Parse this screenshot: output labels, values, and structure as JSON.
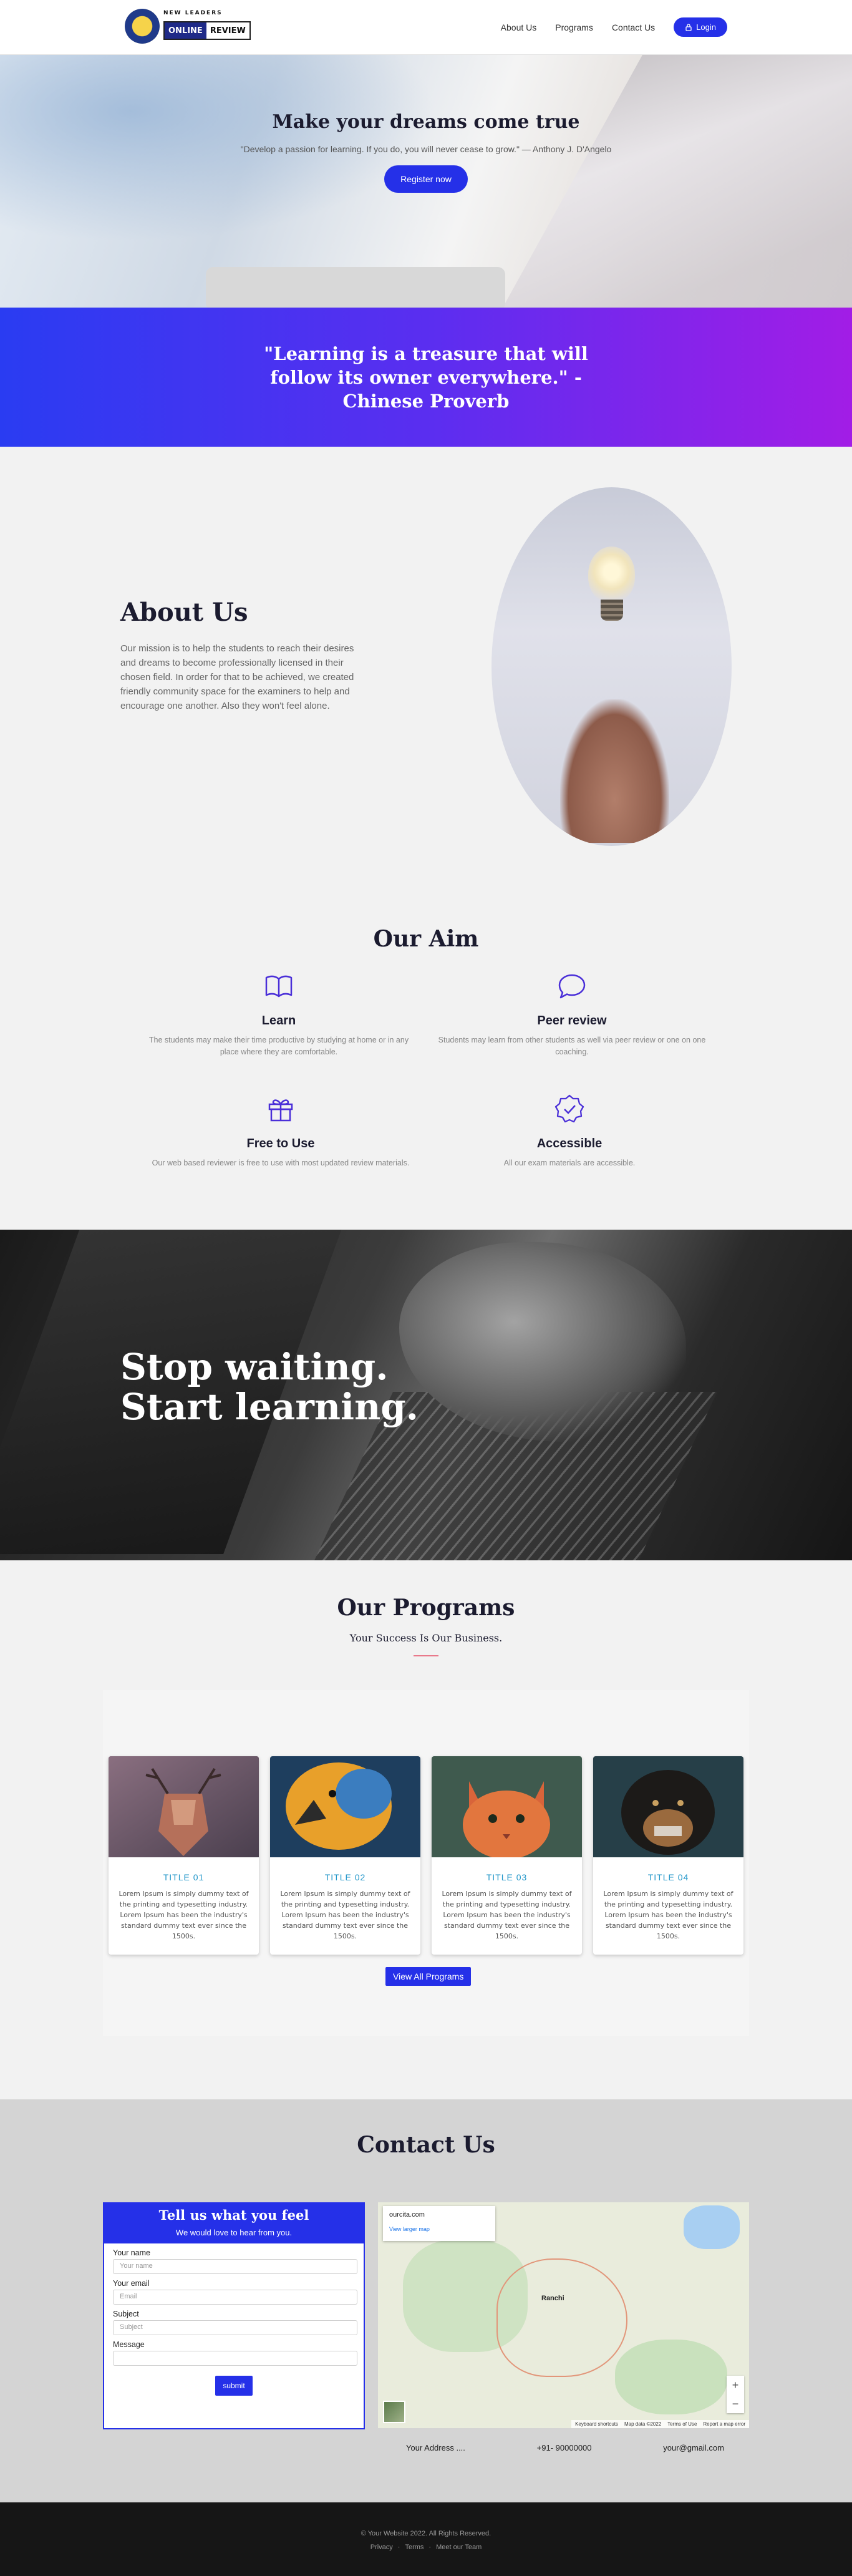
{
  "header": {
    "logo_top": "NEW LEADERS",
    "logo_left": "ONLINE",
    "logo_right": "REVIEW",
    "nav": [
      "About Us",
      "Programs",
      "Contact Us"
    ],
    "login_label": "Login"
  },
  "hero": {
    "title": "Make your dreams come true",
    "quote": "\"Develop a passion for learning. If you do, you will never cease to grow.\" — Anthony J. D'Angelo",
    "button": "Register now"
  },
  "quote_band": {
    "text": "\"Learning is a treasure that will follow its owner everywhere.\" - Chinese Proverb"
  },
  "about": {
    "title": "About Us",
    "text": "Our mission is to help the students to reach their desires and dreams to become professionally licensed in their chosen field. In order for that to be achieved, we created friendly community space for the examiners to help and encourage one another. Also they won't feel alone."
  },
  "aim": {
    "title": "Our Aim",
    "items": [
      {
        "icon": "book-icon",
        "title": "Learn",
        "text": "The students may make their time productive by studying at home or in any place where they are comfortable."
      },
      {
        "icon": "chat-icon",
        "title": "Peer review",
        "text": "Students may learn from other students as well via peer review or one on one coaching."
      },
      {
        "icon": "gift-icon",
        "title": "Free to Use",
        "text": "Our web based reviewer is free to use with most updated review materials."
      },
      {
        "icon": "badge-check-icon",
        "title": "Accessible",
        "text": "All our exam materials are accessible."
      }
    ]
  },
  "stop": {
    "line1": "Stop waiting.",
    "line2": "Start learning."
  },
  "programs": {
    "title": "Our Programs",
    "subtitle": "Your Success Is Our Business.",
    "cards": [
      {
        "title": "TITLE 01",
        "text": "Lorem Ipsum is simply dummy text of the printing and typesetting industry. Lorem Ipsum has been the industry's standard dummy text ever since the 1500s."
      },
      {
        "title": "TITLE 02",
        "text": "Lorem Ipsum is simply dummy text of the printing and typesetting industry. Lorem Ipsum has been the industry's standard dummy text ever since the 1500s."
      },
      {
        "title": "TITLE 03",
        "text": "Lorem Ipsum is simply dummy text of the printing and typesetting industry. Lorem Ipsum has been the industry's standard dummy text ever since the 1500s."
      },
      {
        "title": "TITLE 04",
        "text": "Lorem Ipsum is simply dummy text of the printing and typesetting industry. Lorem Ipsum has been the industry's standard dummy text ever since the 1500s."
      }
    ],
    "button": "View All Programs"
  },
  "contact": {
    "title": "Contact Us",
    "form_title": "Tell us what you feel",
    "form_subtitle": "We would love to hear from you.",
    "fields": [
      {
        "label": "Your name",
        "placeholder": "Your name"
      },
      {
        "label": "Your email",
        "placeholder": "Email"
      },
      {
        "label": "Subject",
        "placeholder": "Subject"
      },
      {
        "label": "Message",
        "placeholder": ""
      }
    ],
    "submit": "submit",
    "map": {
      "card_title": "ourcita.com",
      "card_link": "View larger map",
      "city": "Ranchi",
      "zoom_in": "+",
      "zoom_out": "−",
      "footer": [
        "Keyboard shortcuts",
        "Map data ©2022",
        "Terms of Use",
        "Report a map error"
      ]
    },
    "address": "Your Address ....",
    "phone": "+91- 90000000",
    "email": "your@gmail.com"
  },
  "footer": {
    "copyright": "© Your Website 2022. All Rights Reserved.",
    "links": [
      "Privacy",
      "·",
      "Terms",
      "·",
      "Meet our Team"
    ]
  },
  "colors": {
    "accent": "#2530e8",
    "gradient_end": "#a21de6",
    "card_title": "#2196c9"
  }
}
